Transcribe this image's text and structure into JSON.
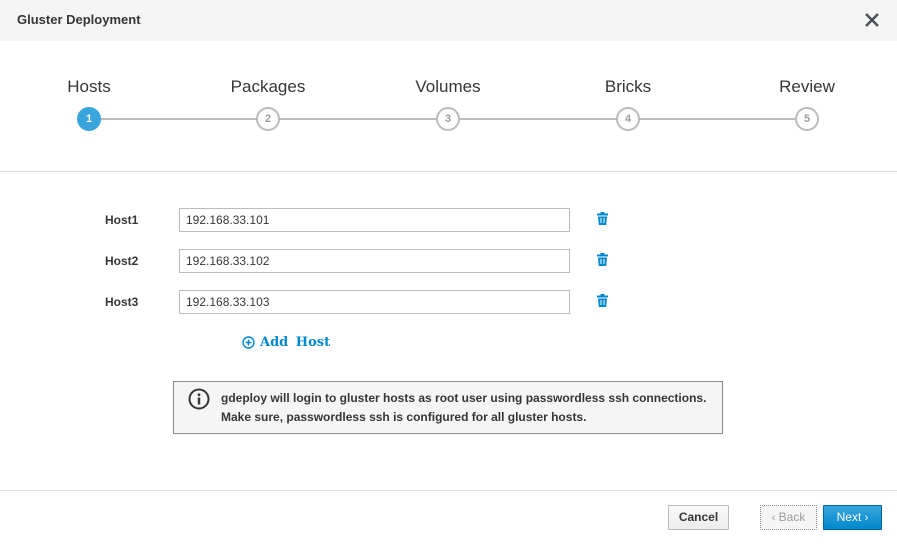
{
  "dialog": {
    "title": "Gluster Deployment"
  },
  "steps": [
    {
      "number": "1",
      "label": "Hosts",
      "active": true
    },
    {
      "number": "2",
      "label": "Packages",
      "active": false
    },
    {
      "number": "3",
      "label": "Volumes",
      "active": false
    },
    {
      "number": "4",
      "label": "Bricks",
      "active": false
    },
    {
      "number": "5",
      "label": "Review",
      "active": false
    }
  ],
  "hosts": [
    {
      "label": "Host1",
      "value": "192.168.33.101"
    },
    {
      "label": "Host2",
      "value": "192.168.33.102"
    },
    {
      "label": "Host3",
      "value": "192.168.33.103"
    }
  ],
  "add_host": {
    "label": "Add Host"
  },
  "info": {
    "text": "gdeploy will login to gluster hosts as root user using passwordless ssh connections. Make sure, passwordless ssh is configured for all gluster hosts."
  },
  "footer": {
    "cancel_label": "Cancel",
    "back_label": "Back",
    "next_label": "Next"
  },
  "colors": {
    "accent": "#0088ce",
    "active_step": "#39a5dc",
    "inactive_step": "#bbbbbb"
  }
}
